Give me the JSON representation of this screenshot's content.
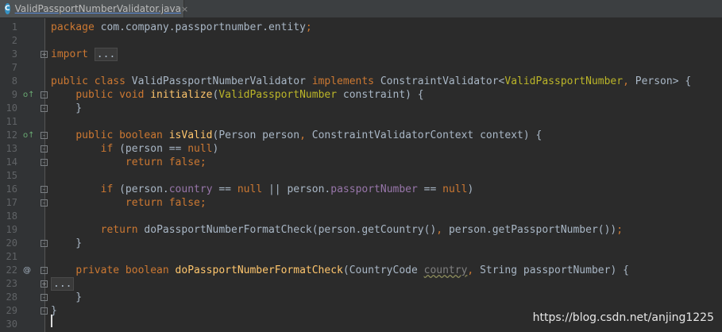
{
  "tab": {
    "icon_letter": "C",
    "file_name": "ValidPassportNumberValidator.java",
    "close_glyph": "×"
  },
  "watermark": "https://blog.csdn.net/anjing1225",
  "lines": [
    {
      "n": "1",
      "tokens": [
        [
          "kw",
          "package "
        ],
        [
          "pl",
          "com.company.passportnumber.entity"
        ],
        [
          "kw",
          ";"
        ]
      ]
    },
    {
      "n": "2",
      "tokens": []
    },
    {
      "n": "3",
      "fold": "+",
      "tokens": [
        [
          "kw",
          "import "
        ],
        [
          "fold-box",
          "..."
        ]
      ]
    },
    {
      "n": "7",
      "tokens": []
    },
    {
      "n": "8",
      "tokens": [
        [
          "kw",
          "public class "
        ],
        [
          "pl",
          "ValidPassportNumberValidator "
        ],
        [
          "kw",
          "implements "
        ],
        [
          "pl",
          "ConstraintValidator<"
        ],
        [
          "ann",
          "ValidPassportNumber"
        ],
        [
          "kw",
          ", "
        ],
        [
          "pl",
          "Person> {"
        ]
      ]
    },
    {
      "n": "9",
      "marker": "o↑",
      "fold": "-",
      "tokens": [
        [
          "pl",
          "    "
        ],
        [
          "kw",
          "public void "
        ],
        [
          "fn",
          "initialize"
        ],
        [
          "pl",
          "("
        ],
        [
          "ann",
          "ValidPassportNumber "
        ],
        [
          "pl",
          "constraint) {"
        ]
      ]
    },
    {
      "n": "10",
      "fold": "-",
      "tokens": [
        [
          "pl",
          "    }"
        ]
      ]
    },
    {
      "n": "11",
      "tokens": []
    },
    {
      "n": "12",
      "marker": "o↑",
      "fold": "-",
      "tokens": [
        [
          "pl",
          "    "
        ],
        [
          "kw",
          "public boolean "
        ],
        [
          "fn",
          "isValid"
        ],
        [
          "pl",
          "(Person person"
        ],
        [
          "kw",
          ", "
        ],
        [
          "pl",
          "ConstraintValidatorContext context) {"
        ]
      ]
    },
    {
      "n": "13",
      "fold": "-",
      "tokens": [
        [
          "pl",
          "        "
        ],
        [
          "kw",
          "if "
        ],
        [
          "pl",
          "(person == "
        ],
        [
          "kw",
          "null"
        ],
        [
          "pl",
          ")"
        ]
      ]
    },
    {
      "n": "14",
      "fold": "-",
      "tokens": [
        [
          "pl",
          "            "
        ],
        [
          "kw",
          "return false;"
        ]
      ]
    },
    {
      "n": "15",
      "tokens": []
    },
    {
      "n": "16",
      "fold": "-",
      "tokens": [
        [
          "pl",
          "        "
        ],
        [
          "kw",
          "if "
        ],
        [
          "pl",
          "(person."
        ],
        [
          "fld",
          "country "
        ],
        [
          "pl",
          "== "
        ],
        [
          "kw",
          "null "
        ],
        [
          "pl",
          "|| person."
        ],
        [
          "fld",
          "passportNumber "
        ],
        [
          "pl",
          "== "
        ],
        [
          "kw",
          "null"
        ],
        [
          "pl",
          ")"
        ]
      ]
    },
    {
      "n": "17",
      "fold": "-",
      "tokens": [
        [
          "pl",
          "            "
        ],
        [
          "kw",
          "return false;"
        ]
      ]
    },
    {
      "n": "18",
      "tokens": []
    },
    {
      "n": "19",
      "tokens": [
        [
          "pl",
          "        "
        ],
        [
          "kw",
          "return "
        ],
        [
          "pl",
          "doPassportNumberFormatCheck(person.getCountry()"
        ],
        [
          "kw",
          ", "
        ],
        [
          "pl",
          "person.getPassportNumber())"
        ],
        [
          "kw",
          ";"
        ]
      ]
    },
    {
      "n": "20",
      "fold": "-",
      "tokens": [
        [
          "pl",
          "    }"
        ]
      ]
    },
    {
      "n": "21",
      "tokens": []
    },
    {
      "n": "22",
      "marker": "@",
      "fold": "-",
      "tokens": [
        [
          "pl",
          "    "
        ],
        [
          "kw",
          "private boolean "
        ],
        [
          "fn",
          "doPassportNumberFormatCheck"
        ],
        [
          "pl",
          "(CountryCode "
        ],
        [
          "warn",
          "country"
        ],
        [
          "kw",
          ", "
        ],
        [
          "pl",
          "String passportNumber) {"
        ]
      ]
    },
    {
      "n": "23",
      "fold": "+",
      "tokens": [
        [
          "fold-box",
          "..."
        ]
      ]
    },
    {
      "n": "28",
      "fold": "-",
      "tokens": [
        [
          "pl",
          "    }"
        ]
      ]
    },
    {
      "n": "29",
      "fold": "-",
      "tokens": [
        [
          "pl",
          "}"
        ]
      ]
    },
    {
      "n": "30",
      "tokens": []
    }
  ]
}
